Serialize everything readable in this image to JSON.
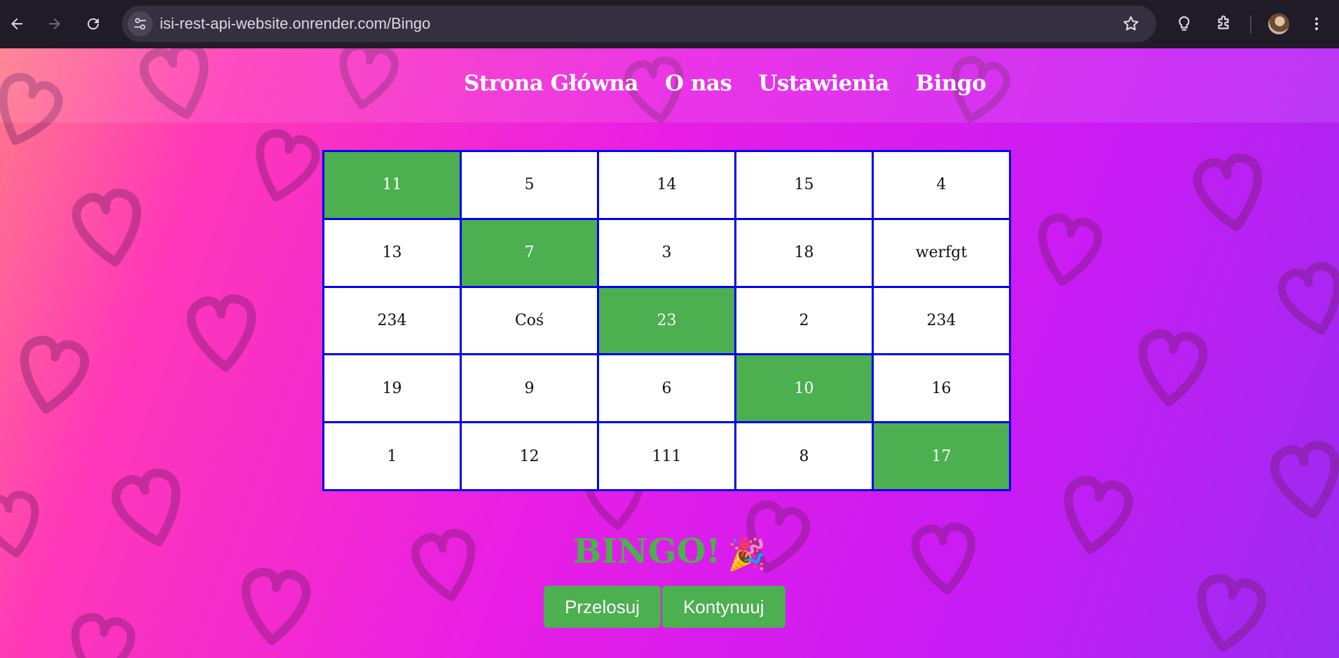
{
  "browser": {
    "url": "isi-rest-api-website.onrender.com/Bingo",
    "back_icon": "arrow-left-icon",
    "forward_icon": "arrow-right-icon",
    "reload_icon": "reload-icon",
    "bookmark_icon": "star-icon"
  },
  "nav": {
    "items": [
      {
        "label": "Strona Główna"
      },
      {
        "label": "O nas"
      },
      {
        "label": "Ustawienia"
      },
      {
        "label": "Bingo"
      }
    ]
  },
  "board": {
    "rows": [
      [
        {
          "v": "11",
          "marked": true
        },
        {
          "v": "5",
          "marked": false
        },
        {
          "v": "14",
          "marked": false
        },
        {
          "v": "15",
          "marked": false
        },
        {
          "v": "4",
          "marked": false
        }
      ],
      [
        {
          "v": "13",
          "marked": false
        },
        {
          "v": "7",
          "marked": true
        },
        {
          "v": "3",
          "marked": false
        },
        {
          "v": "18",
          "marked": false
        },
        {
          "v": "werfgt",
          "marked": false
        }
      ],
      [
        {
          "v": "234",
          "marked": false
        },
        {
          "v": "Coś",
          "marked": false
        },
        {
          "v": "23",
          "marked": true
        },
        {
          "v": "2",
          "marked": false
        },
        {
          "v": "234",
          "marked": false
        }
      ],
      [
        {
          "v": "19",
          "marked": false
        },
        {
          "v": "9",
          "marked": false
        },
        {
          "v": "6",
          "marked": false
        },
        {
          "v": "10",
          "marked": true
        },
        {
          "v": "16",
          "marked": false
        }
      ],
      [
        {
          "v": "1",
          "marked": false
        },
        {
          "v": "12",
          "marked": false
        },
        {
          "v": "111",
          "marked": false
        },
        {
          "v": "8",
          "marked": false
        },
        {
          "v": "17",
          "marked": true
        }
      ]
    ],
    "marked_color": "#4caf50",
    "border_color": "#0000f0"
  },
  "result": {
    "text": "BINGO!",
    "emoji": "🎉"
  },
  "buttons": {
    "reshuffle": "Przelosuj",
    "continue": "Kontynuuj"
  },
  "colors": {
    "accent": "#4caf50",
    "background_start": "#ff7a8a",
    "background_end": "#9a2bf0"
  }
}
